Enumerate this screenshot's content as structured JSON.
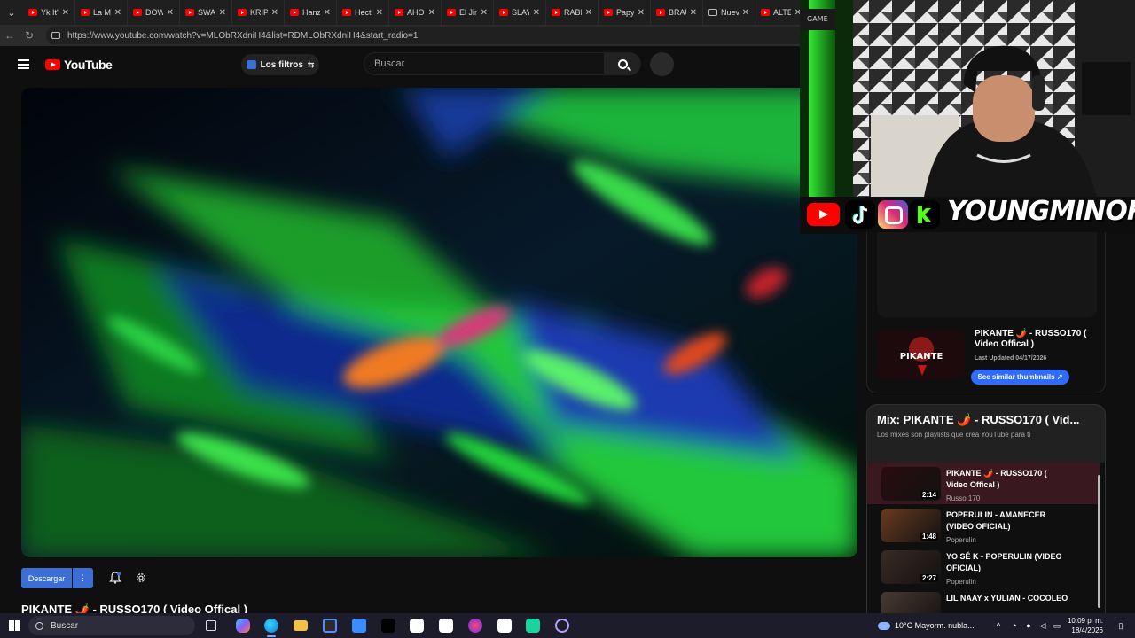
{
  "browser": {
    "tabs": [
      {
        "label": "Yk It's",
        "favicon": "youtube-icon"
      },
      {
        "label": "La M",
        "favicon": "youtube-icon"
      },
      {
        "label": "DOW",
        "favicon": "youtube-icon"
      },
      {
        "label": "SWA",
        "favicon": "youtube-icon"
      },
      {
        "label": "KRIP",
        "favicon": "youtube-icon"
      },
      {
        "label": "Hanz",
        "favicon": "youtube-icon"
      },
      {
        "label": "Hect",
        "favicon": "youtube-icon"
      },
      {
        "label": "AHO",
        "favicon": "youtube-icon"
      },
      {
        "label": "El Jin",
        "favicon": "youtube-icon"
      },
      {
        "label": "SLAY",
        "favicon": "youtube-icon"
      },
      {
        "label": "RABI",
        "favicon": "youtube-icon"
      },
      {
        "label": "Papy",
        "favicon": "youtube-icon"
      },
      {
        "label": "BRAU",
        "favicon": "youtube-icon"
      },
      {
        "label": "Nuev",
        "favicon": "document-icon"
      },
      {
        "label": "ALTE",
        "favicon": "youtube-icon"
      }
    ],
    "url": "https://www.youtube.com/watch?v=MLObRXdniH4&list=RDMLObRXdniH4&start_radio=1"
  },
  "youtube": {
    "logo_text": "YouTube",
    "filters_label": "Los filtros",
    "search_placeholder": "Buscar",
    "download_label": "Descargar",
    "video_title": "PIKANTE 🌶️ - RUSSO170 ( Video Offical )"
  },
  "stream_overlay": {
    "channel_name": "YOUNGMINOR",
    "social_icons": [
      "youtube-icon",
      "tiktok-icon",
      "instagram-icon",
      "kick-icon"
    ]
  },
  "sidebar": {
    "ad": {
      "title": "PIKANTE 🌶️ - RUSSO170 ( Video Offical )",
      "updated": "Last Updated 04/17/2026",
      "button_label": "See similar thumbnails ↗"
    },
    "mix": {
      "title": "Mix: PIKANTE 🌶️ - RUSSO170 ( Vid...",
      "subtitle": "Los mixes son playlists que crea YouTube para ti",
      "items": [
        {
          "title": "PIKANTE 🌶️ - RUSSO170 ( Video Offical )",
          "artist": "Russo 170",
          "duration": "2:14",
          "active": true
        },
        {
          "title": "POPERULIN - AMANECER (VIDEO OFICIAL)",
          "artist": "Poperulin",
          "duration": "1:48",
          "active": false
        },
        {
          "title": "YO SÉ K - POPERULIN (VIDEO OFICIAL)",
          "artist": "Poperulin",
          "duration": "2:27",
          "active": false
        },
        {
          "title": "LIL NAAY x YULIAN - COCOLEO",
          "artist": "",
          "duration": "",
          "active": false
        }
      ]
    }
  },
  "taskbar": {
    "search_label": "Buscar",
    "weather": "10°C  Mayorm. nubla...",
    "time": "10:09 p. m.",
    "date": "18/4/2026"
  },
  "colors": {
    "accent_blue": "#3b6fd6",
    "youtube_red": "#ff0000",
    "active_row": "#3a1820",
    "page_bg": "#0f0f0f"
  }
}
